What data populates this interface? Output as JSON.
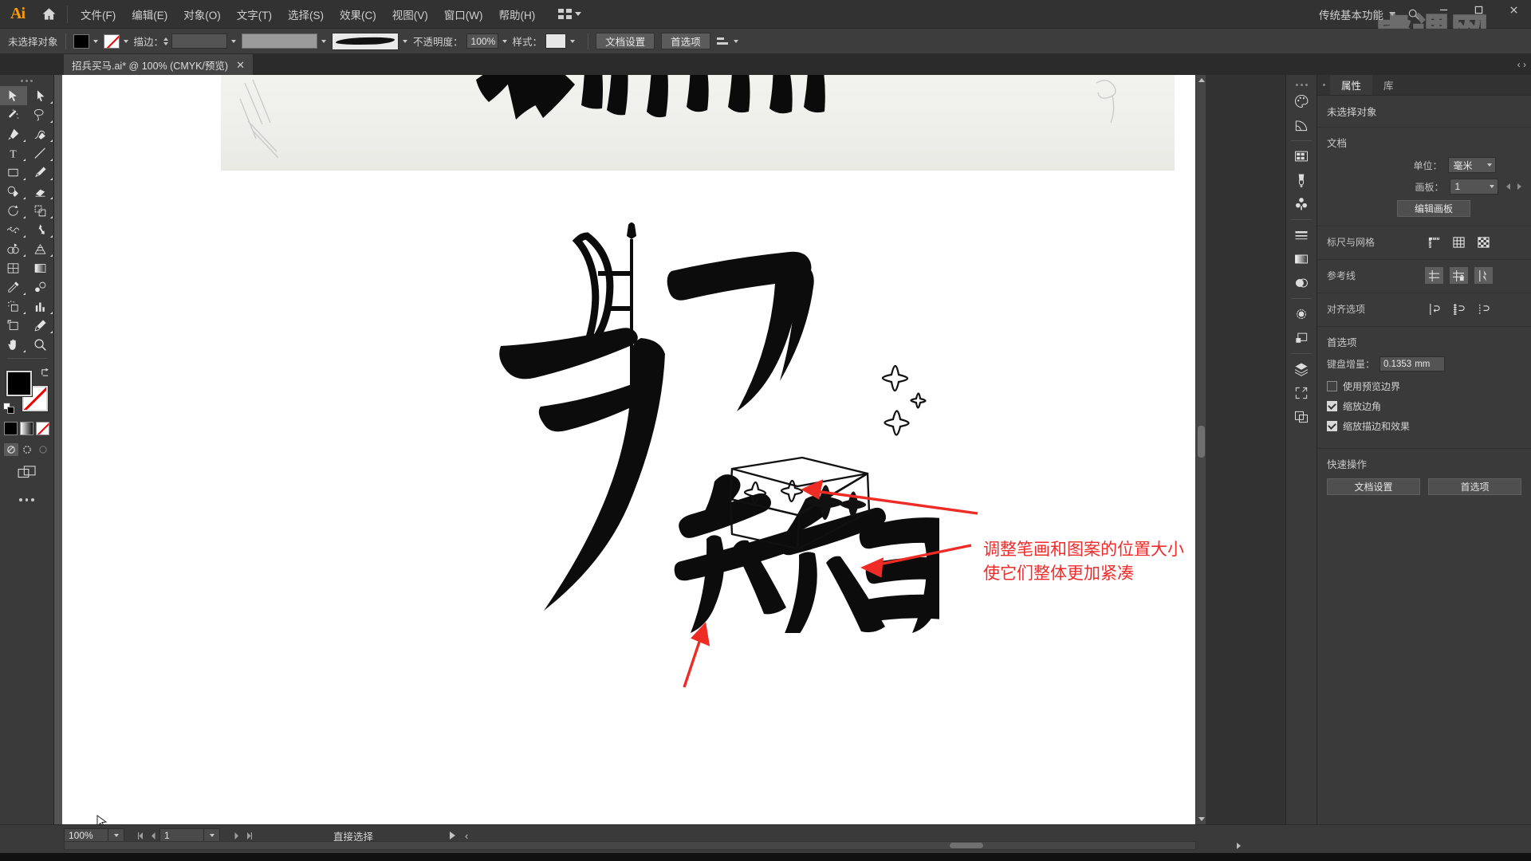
{
  "app": {
    "name": "Adobe Illustrator",
    "logo_text": "Ai",
    "home_icon": "home-icon"
  },
  "menubar": {
    "items": [
      {
        "label": "文件(F)",
        "name": "menu-file"
      },
      {
        "label": "编辑(E)",
        "name": "menu-edit"
      },
      {
        "label": "对象(O)",
        "name": "menu-object"
      },
      {
        "label": "文字(T)",
        "name": "menu-type"
      },
      {
        "label": "选择(S)",
        "name": "menu-select"
      },
      {
        "label": "效果(C)",
        "name": "menu-effect"
      },
      {
        "label": "视图(V)",
        "name": "menu-view"
      },
      {
        "label": "窗口(W)",
        "name": "menu-window"
      },
      {
        "label": "帮助(H)",
        "name": "menu-help"
      }
    ],
    "workspace": "传统基本功能",
    "search_icon": "search-icon",
    "window_buttons": {
      "minimize": "—",
      "maximize": "□",
      "close": "✕"
    },
    "watermark": "虎课网"
  },
  "controlbar": {
    "selection_status": "未选择对象",
    "fill_label": "fill-swatch",
    "stroke_label": "stroke-swatch",
    "stroke_text": "描边：",
    "stroke_weight": "",
    "stroke_profile": "",
    "brush_definition": "brush-stroke",
    "opacity_label": "不透明度：",
    "opacity_value": "100%",
    "style_label": "样式：",
    "doc_setup": "文档设置",
    "preferences": "首选项",
    "align_icon": "align-icon"
  },
  "tabbar": {
    "document": "招兵买马.ai* @ 100% (CMYK/预览)",
    "close": "✕"
  },
  "toolbar": {
    "tools": [
      {
        "name": "selection-tool",
        "label": "选择工具",
        "active": true
      },
      {
        "name": "direct-selection-tool",
        "label": "直接选择工具",
        "active": false
      },
      {
        "name": "magic-wand-tool",
        "label": "魔棒工具",
        "active": false
      },
      {
        "name": "lasso-tool",
        "label": "套索工具",
        "active": false
      },
      {
        "name": "pen-tool",
        "label": "钢笔工具",
        "active": false
      },
      {
        "name": "curvature-tool",
        "label": "曲率工具",
        "active": false
      },
      {
        "name": "type-tool",
        "label": "文字工具",
        "active": false
      },
      {
        "name": "line-segment-tool",
        "label": "直线段工具",
        "active": false
      },
      {
        "name": "rectangle-tool",
        "label": "矩形工具",
        "active": false
      },
      {
        "name": "paintbrush-tool",
        "label": "画笔工具",
        "active": false
      },
      {
        "name": "shaper-tool",
        "label": "Shaper 工具",
        "active": false
      },
      {
        "name": "eraser-tool",
        "label": "橡皮擦工具",
        "active": false
      },
      {
        "name": "rotate-tool",
        "label": "旋转工具",
        "active": false
      },
      {
        "name": "scale-tool",
        "label": "比例缩放工具",
        "active": false
      },
      {
        "name": "width-tool",
        "label": "宽度工具",
        "active": false
      },
      {
        "name": "free-transform-tool",
        "label": "自由变换工具",
        "active": false
      },
      {
        "name": "shape-builder-tool",
        "label": "形状生成器工具",
        "active": false
      },
      {
        "name": "perspective-grid-tool",
        "label": "透视网格工具",
        "active": false
      },
      {
        "name": "mesh-tool",
        "label": "网格工具",
        "active": false
      },
      {
        "name": "gradient-tool",
        "label": "渐变工具",
        "active": false
      },
      {
        "name": "eyedropper-tool",
        "label": "吸管工具",
        "active": false
      },
      {
        "name": "blend-tool",
        "label": "混合工具",
        "active": false
      },
      {
        "name": "symbol-sprayer-tool",
        "label": "符号喷枪工具",
        "active": false
      },
      {
        "name": "column-graph-tool",
        "label": "柱形图工具",
        "active": false
      },
      {
        "name": "artboard-tool",
        "label": "画板工具",
        "active": false
      },
      {
        "name": "slice-tool",
        "label": "切片工具",
        "active": false
      },
      {
        "name": "hand-tool",
        "label": "抓手工具",
        "active": false
      },
      {
        "name": "zoom-tool",
        "label": "缩放工具",
        "active": false
      }
    ],
    "fill_color": "#000000",
    "stroke_color": "none",
    "swap_icon": "swap-fill-stroke-icon",
    "default_icon": "default-fill-stroke-icon",
    "color_modes": [
      "color-mode-flat",
      "color-mode-gradient",
      "color-mode-none"
    ],
    "draw_modes": [
      "draw-normal",
      "draw-behind",
      "draw-inside"
    ],
    "screen_mode": "change-screen-mode-icon",
    "more_tools": "edit-toolbar-icon"
  },
  "canvas": {
    "artwork_title": "招兵买马",
    "annotation_line1": "调整笔画和图案的位置大小",
    "annotation_line2": "使它们整体更加紧凑",
    "annotation_color": "#ef2b2b",
    "arrow_color": "#ee2b24",
    "artboard_bg": "#ffffff",
    "pasteboard_bg": "#535353"
  },
  "icondock": {
    "items": [
      {
        "name": "color-panel-icon",
        "label": "颜色"
      },
      {
        "name": "color-guide-panel-icon",
        "label": "颜色参考"
      },
      {
        "name": "swatches-panel-icon",
        "label": "色板"
      },
      {
        "name": "brushes-panel-icon",
        "label": "画笔"
      },
      {
        "name": "symbols-panel-icon",
        "label": "符号"
      },
      {
        "name": "stroke-panel-icon",
        "label": "描边"
      },
      {
        "name": "gradient-panel-icon",
        "label": "渐变"
      },
      {
        "name": "transparency-panel-icon",
        "label": "透明度"
      },
      {
        "name": "appearance-panel-icon",
        "label": "外观"
      },
      {
        "name": "graphic-styles-panel-icon",
        "label": "图形样式"
      },
      {
        "name": "layers-panel-icon",
        "label": "图层"
      },
      {
        "name": "artboards-panel-icon",
        "label": "画板"
      },
      {
        "name": "asset-export-panel-icon",
        "label": "资源导出"
      }
    ]
  },
  "properties": {
    "tabs": [
      {
        "label": "属性",
        "name": "tab-properties",
        "active": true
      },
      {
        "label": "库",
        "name": "tab-libraries",
        "active": false
      }
    ],
    "selection_status": "未选择对象",
    "document": {
      "title": "文档",
      "unit_label": "单位：",
      "unit_value": "毫米",
      "artboard_label": "画板：",
      "artboard_value": "1",
      "edit_artboards": "编辑画板"
    },
    "rulers_grids": {
      "label": "标尺与网格",
      "icons": [
        "show-rulers-icon",
        "show-grid-icon",
        "show-transparency-grid-icon"
      ]
    },
    "guides": {
      "label": "参考线",
      "icons": [
        "show-guides-icon",
        "lock-guides-icon",
        "smart-guides-icon"
      ]
    },
    "align_options": {
      "label": "对齐选项",
      "icons": [
        "align-to-path-icon",
        "align-to-pixel-grid-icon",
        "align-to-point-icon"
      ]
    },
    "preferences": {
      "title": "首选项",
      "keyboard_increment_label": "键盘增量：",
      "keyboard_increment_value": "0.1353",
      "keyboard_increment_unit": "mm",
      "checkboxes": [
        {
          "label": "使用预览边界",
          "checked": false,
          "name": "use-preview-bounds-checkbox"
        },
        {
          "label": "缩放边角",
          "checked": true,
          "name": "scale-corners-checkbox"
        },
        {
          "label": "缩放描边和效果",
          "checked": true,
          "name": "scale-strokes-effects-checkbox"
        }
      ]
    },
    "quick_actions": {
      "title": "快速操作",
      "buttons": [
        "文档设置",
        "首选项"
      ]
    }
  },
  "statusbar": {
    "zoom": "100%",
    "artboard_number": "1",
    "status_text": "直接选择"
  },
  "colors": {
    "chrome_dark": "#323232",
    "chrome_panel": "#3a3a3a",
    "chrome_control": "#3d3d3d",
    "pasteboard": "#535353",
    "accent_orange": "#ff9a00",
    "annotation_red": "#ef2b2b"
  }
}
